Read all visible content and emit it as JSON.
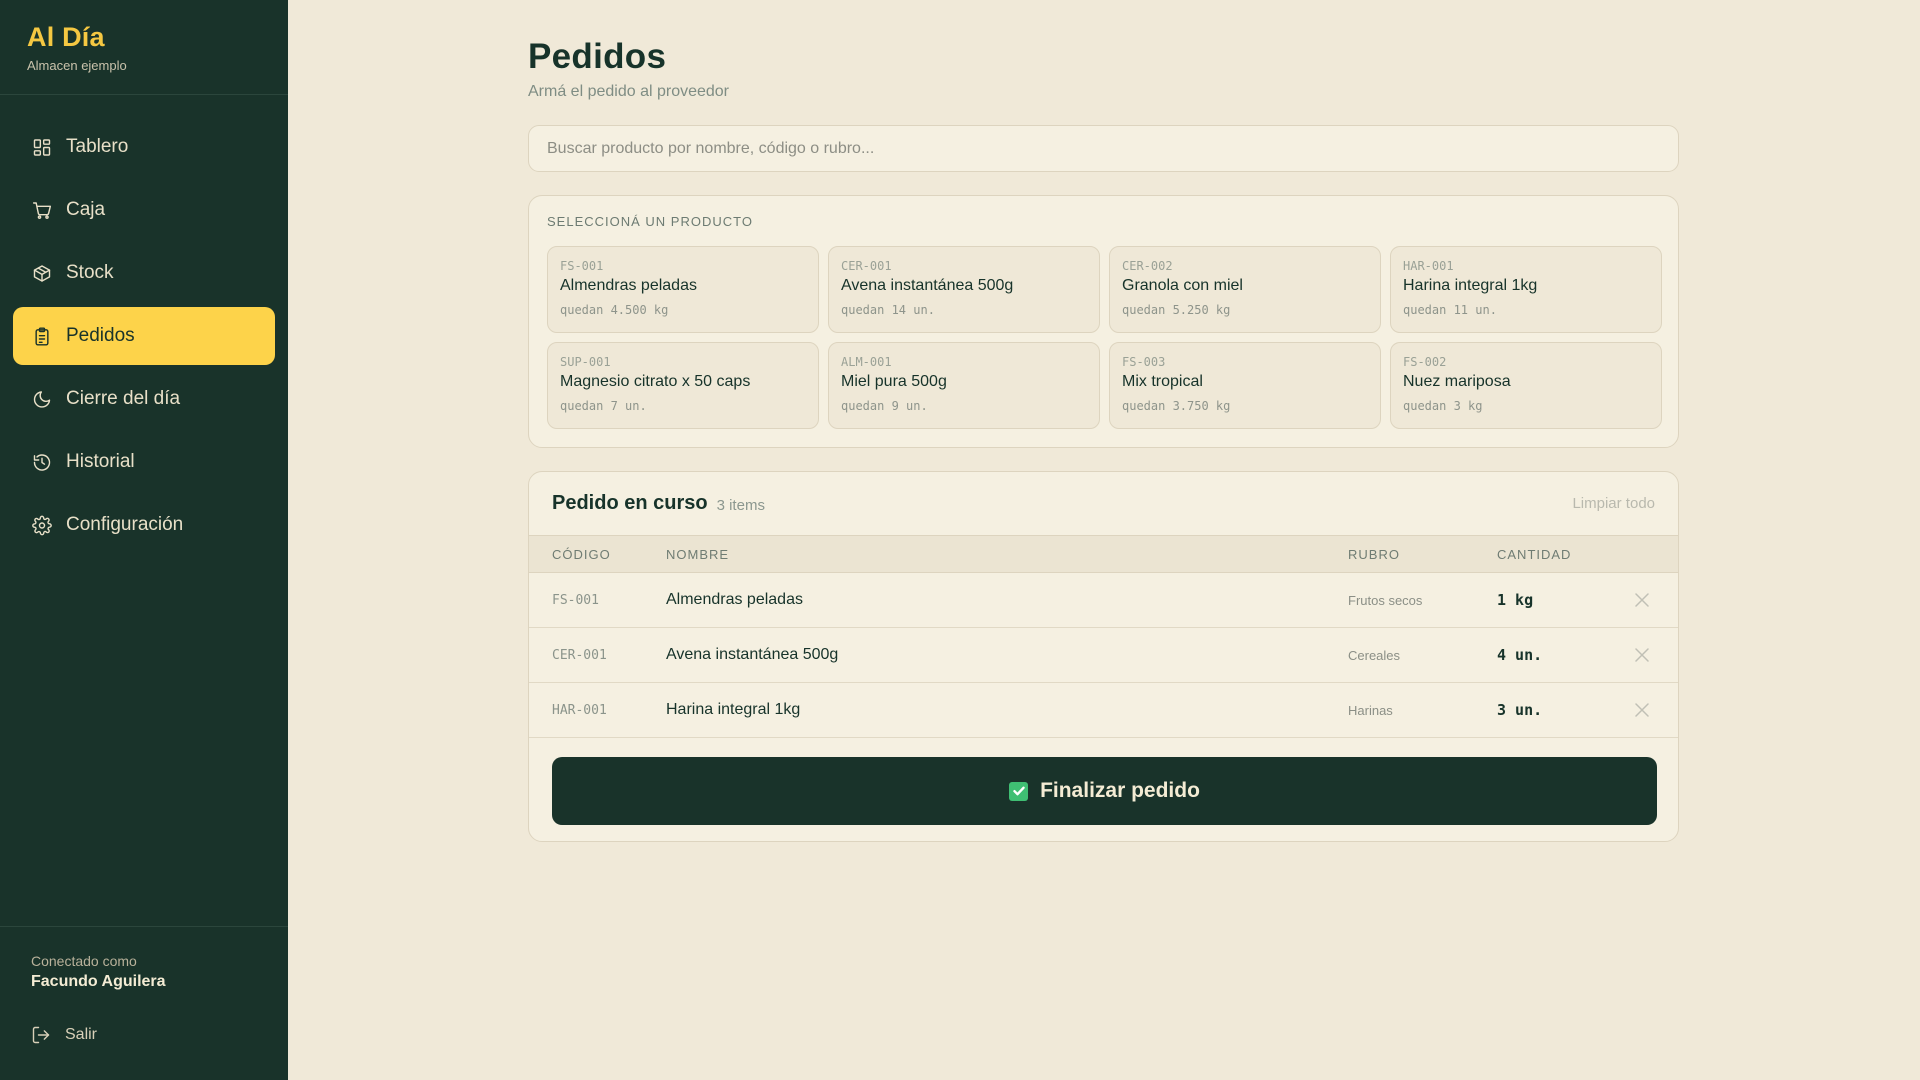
{
  "brand": {
    "title": "Al Día",
    "subtitle": "Almacen ejemplo"
  },
  "nav": {
    "items": [
      {
        "label": "Tablero",
        "icon": "dashboard-icon"
      },
      {
        "label": "Caja",
        "icon": "cart-icon"
      },
      {
        "label": "Stock",
        "icon": "box-icon"
      },
      {
        "label": "Pedidos",
        "icon": "clipboard-icon",
        "active": true
      },
      {
        "label": "Cierre del día",
        "icon": "moon-icon"
      },
      {
        "label": "Historial",
        "icon": "history-icon"
      },
      {
        "label": "Configuración",
        "icon": "gear-icon"
      }
    ]
  },
  "footer": {
    "connected_label": "Conectado como",
    "user": "Facundo Aguilera",
    "logout": "Salir"
  },
  "page": {
    "title": "Pedidos",
    "subtitle": "Armá el pedido al proveedor"
  },
  "search": {
    "placeholder": "Buscar producto por nombre, código o rubro..."
  },
  "products": {
    "label": "SELECCIONÁ UN PRODUCTO",
    "items": [
      {
        "code": "FS-001",
        "name": "Almendras peladas",
        "stock": "quedan 4.500 kg"
      },
      {
        "code": "CER-001",
        "name": "Avena instantánea 500g",
        "stock": "quedan 14 un."
      },
      {
        "code": "CER-002",
        "name": "Granola con miel",
        "stock": "quedan 5.250 kg"
      },
      {
        "code": "HAR-001",
        "name": "Harina integral 1kg",
        "stock": "quedan 11 un."
      },
      {
        "code": "SUP-001",
        "name": "Magnesio citrato x 50 caps",
        "stock": "quedan 7 un."
      },
      {
        "code": "ALM-001",
        "name": "Miel pura 500g",
        "stock": "quedan 9 un."
      },
      {
        "code": "FS-003",
        "name": "Mix tropical",
        "stock": "quedan 3.750 kg"
      },
      {
        "code": "FS-002",
        "name": "Nuez mariposa",
        "stock": "quedan 3 kg"
      }
    ]
  },
  "order": {
    "title": "Pedido en curso",
    "count": "3 items",
    "clear": "Limpiar todo",
    "columns": {
      "code": "CÓDIGO",
      "name": "NOMBRE",
      "rubro": "RUBRO",
      "qty": "CANTIDAD"
    },
    "rows": [
      {
        "code": "FS-001",
        "name": "Almendras peladas",
        "rubro": "Frutos secos",
        "qty": "1 kg"
      },
      {
        "code": "CER-001",
        "name": "Avena instantánea 500g",
        "rubro": "Cereales",
        "qty": "4 un."
      },
      {
        "code": "HAR-001",
        "name": "Harina integral 1kg",
        "rubro": "Harinas",
        "qty": "3 un."
      }
    ],
    "finish": "Finalizar pedido"
  },
  "colors": {
    "sidebar": "#19332a",
    "accent": "#fdd34a",
    "background": "#f0e9d8",
    "check": "#3fbf73"
  }
}
